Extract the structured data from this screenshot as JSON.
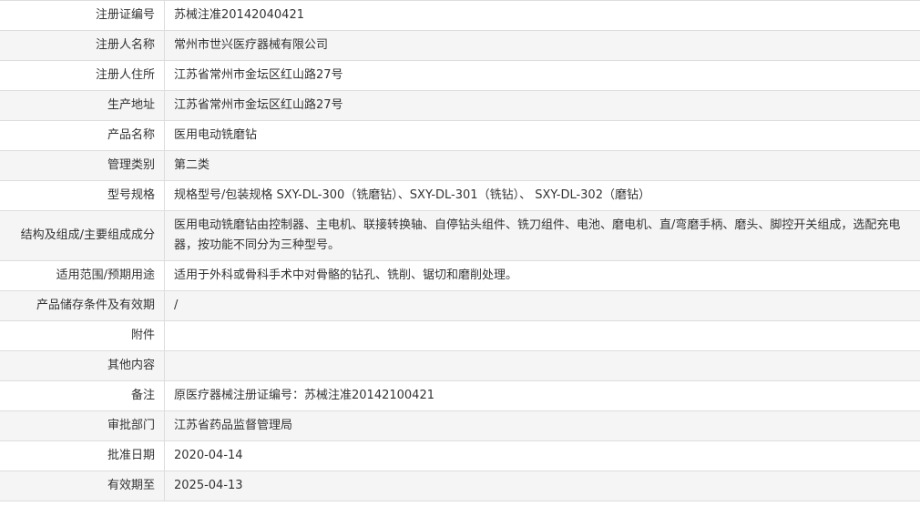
{
  "rows": [
    {
      "label": "注册证编号",
      "value": "苏械注准20142040421"
    },
    {
      "label": "注册人名称",
      "value": "常州市世兴医疗器械有限公司"
    },
    {
      "label": "注册人住所",
      "value": "江苏省常州市金坛区红山路27号"
    },
    {
      "label": "生产地址",
      "value": "江苏省常州市金坛区红山路27号"
    },
    {
      "label": "产品名称",
      "value": "医用电动铣磨钻"
    },
    {
      "label": "管理类别",
      "value": "第二类"
    },
    {
      "label": "型号规格",
      "value": "规格型号/包装规格 SXY-DL-300（铣磨钻）、SXY-DL-301（铣钻）、 SXY-DL-302（磨钻）"
    },
    {
      "label": "结构及组成/主要组成成分",
      "value": "医用电动铣磨钻由控制器、主电机、联接转换轴、自停钻头组件、铣刀组件、电池、磨电机、直/弯磨手柄、磨头、脚控开关组成，选配充电器，按功能不同分为三种型号。"
    },
    {
      "label": "适用范围/预期用途",
      "value": "适用于外科或骨科手术中对骨骼的钻孔、铣削、锯切和磨削处理。"
    },
    {
      "label": "产品储存条件及有效期",
      "value": "/"
    },
    {
      "label": "附件",
      "value": ""
    },
    {
      "label": "其他内容",
      "value": ""
    },
    {
      "label": "备注",
      "value": "原医疗器械注册证编号：苏械注准20142100421"
    },
    {
      "label": "审批部门",
      "value": "江苏省药品监督管理局"
    },
    {
      "label": "批准日期",
      "value": "2020-04-14"
    },
    {
      "label": "有效期至",
      "value": "2025-04-13"
    }
  ]
}
